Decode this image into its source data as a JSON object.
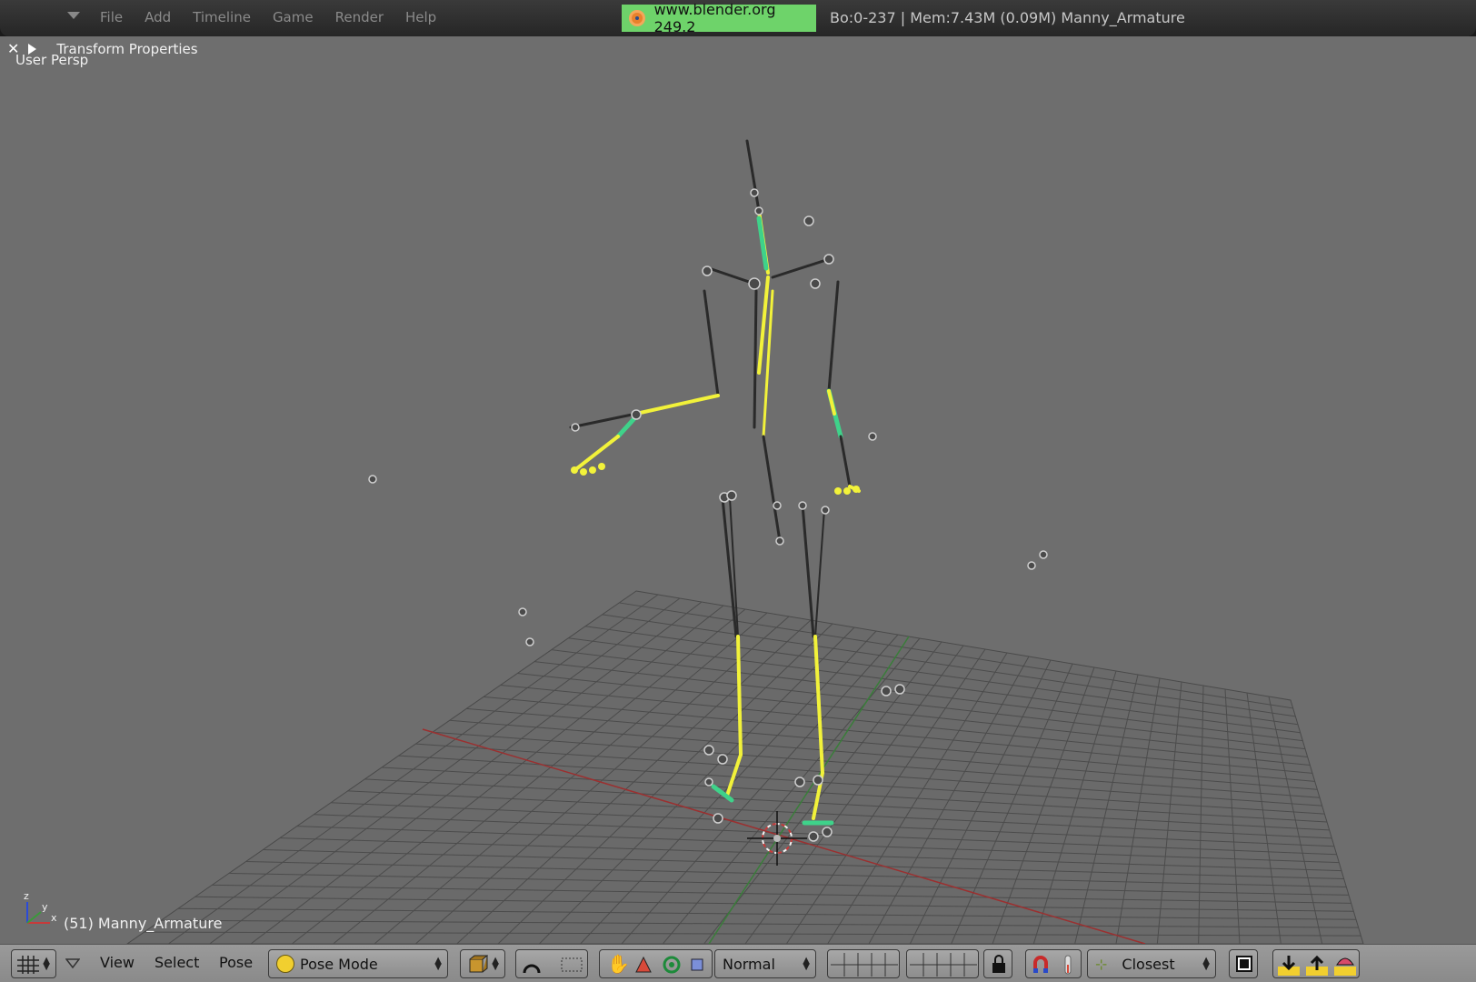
{
  "top_menu": {
    "items": [
      "File",
      "Add",
      "Timeline",
      "Game",
      "Render",
      "Help"
    ],
    "brand_url": "www.blender.org 249.2",
    "stats": "Bo:0-237  | Mem:7.43M (0.09M) Manny_Armature"
  },
  "viewport": {
    "panel_title": "Transform Properties",
    "view_label": "User Persp",
    "object_label": "(51) Manny_Armature",
    "colors": {
      "background": "#6e6e6e",
      "grid": "#4c4c4c",
      "bone": "#2a2a2a",
      "bone_selected": "#f2f23a",
      "bone_active": "#3fd28a",
      "x_axis": "#9b3030",
      "y_axis": "#3a7d3a"
    }
  },
  "bottom_bar": {
    "menus": [
      "View",
      "Select",
      "Pose"
    ],
    "mode": "Pose Mode",
    "orientation": "Normal",
    "snap": "Closest",
    "icons": [
      "viewport-type-icon",
      "draw-type-icon",
      "pivot-icon",
      "manipulator-hand-icon",
      "translate-icon",
      "rotate-icon",
      "scale-icon",
      "layer-lock-icon",
      "magnet-icon",
      "thermometer-icon",
      "snap-target-icon",
      "render-preview-icon",
      "export-down-icon",
      "export-up-icon",
      "flag-icon"
    ]
  }
}
